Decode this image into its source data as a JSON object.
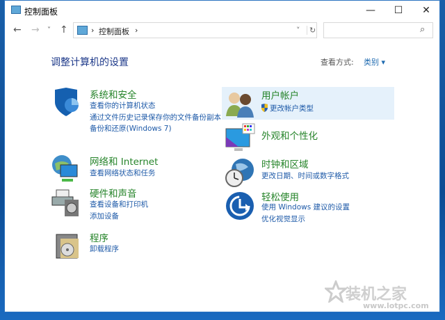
{
  "window": {
    "title": "控制面板",
    "minimize": "—",
    "maximize": "☐",
    "close": "✕"
  },
  "nav": {
    "back": "←",
    "forward": "→",
    "recent": "˅",
    "up": "↑"
  },
  "address": {
    "sep1": "›",
    "crumb": "控制面板",
    "sep2": "›",
    "dropdown": "˅",
    "refresh": "↻"
  },
  "search": {
    "placeholder": "",
    "icon": "⌕"
  },
  "main": {
    "heading": "调整计算机的设置",
    "view_label": "查看方式:",
    "view_value": "类别 ▾"
  },
  "categories": [
    {
      "title": "系统和安全",
      "links": [
        "查看你的计算机状态",
        "通过文件历史记录保存你的文件备份副本",
        "备份和还原(Windows 7)"
      ]
    },
    {
      "title": "网络和 Internet",
      "links": [
        "查看网络状态和任务"
      ]
    },
    {
      "title": "硬件和声音",
      "links": [
        "查看设备和打印机",
        "添加设备"
      ]
    },
    {
      "title": "程序",
      "links": [
        "卸载程序"
      ]
    },
    {
      "title": "用户帐户",
      "links": [
        "更改帐户类型"
      ]
    },
    {
      "title": "外观和个性化",
      "links": []
    },
    {
      "title": "时钟和区域",
      "links": [
        "更改日期、时间或数字格式"
      ]
    },
    {
      "title": "轻松使用",
      "links": [
        "使用 Windows 建议的设置",
        "优化视觉显示"
      ]
    }
  ],
  "watermark": {
    "name": "装机之家",
    "url": "www.lotpc.com"
  }
}
